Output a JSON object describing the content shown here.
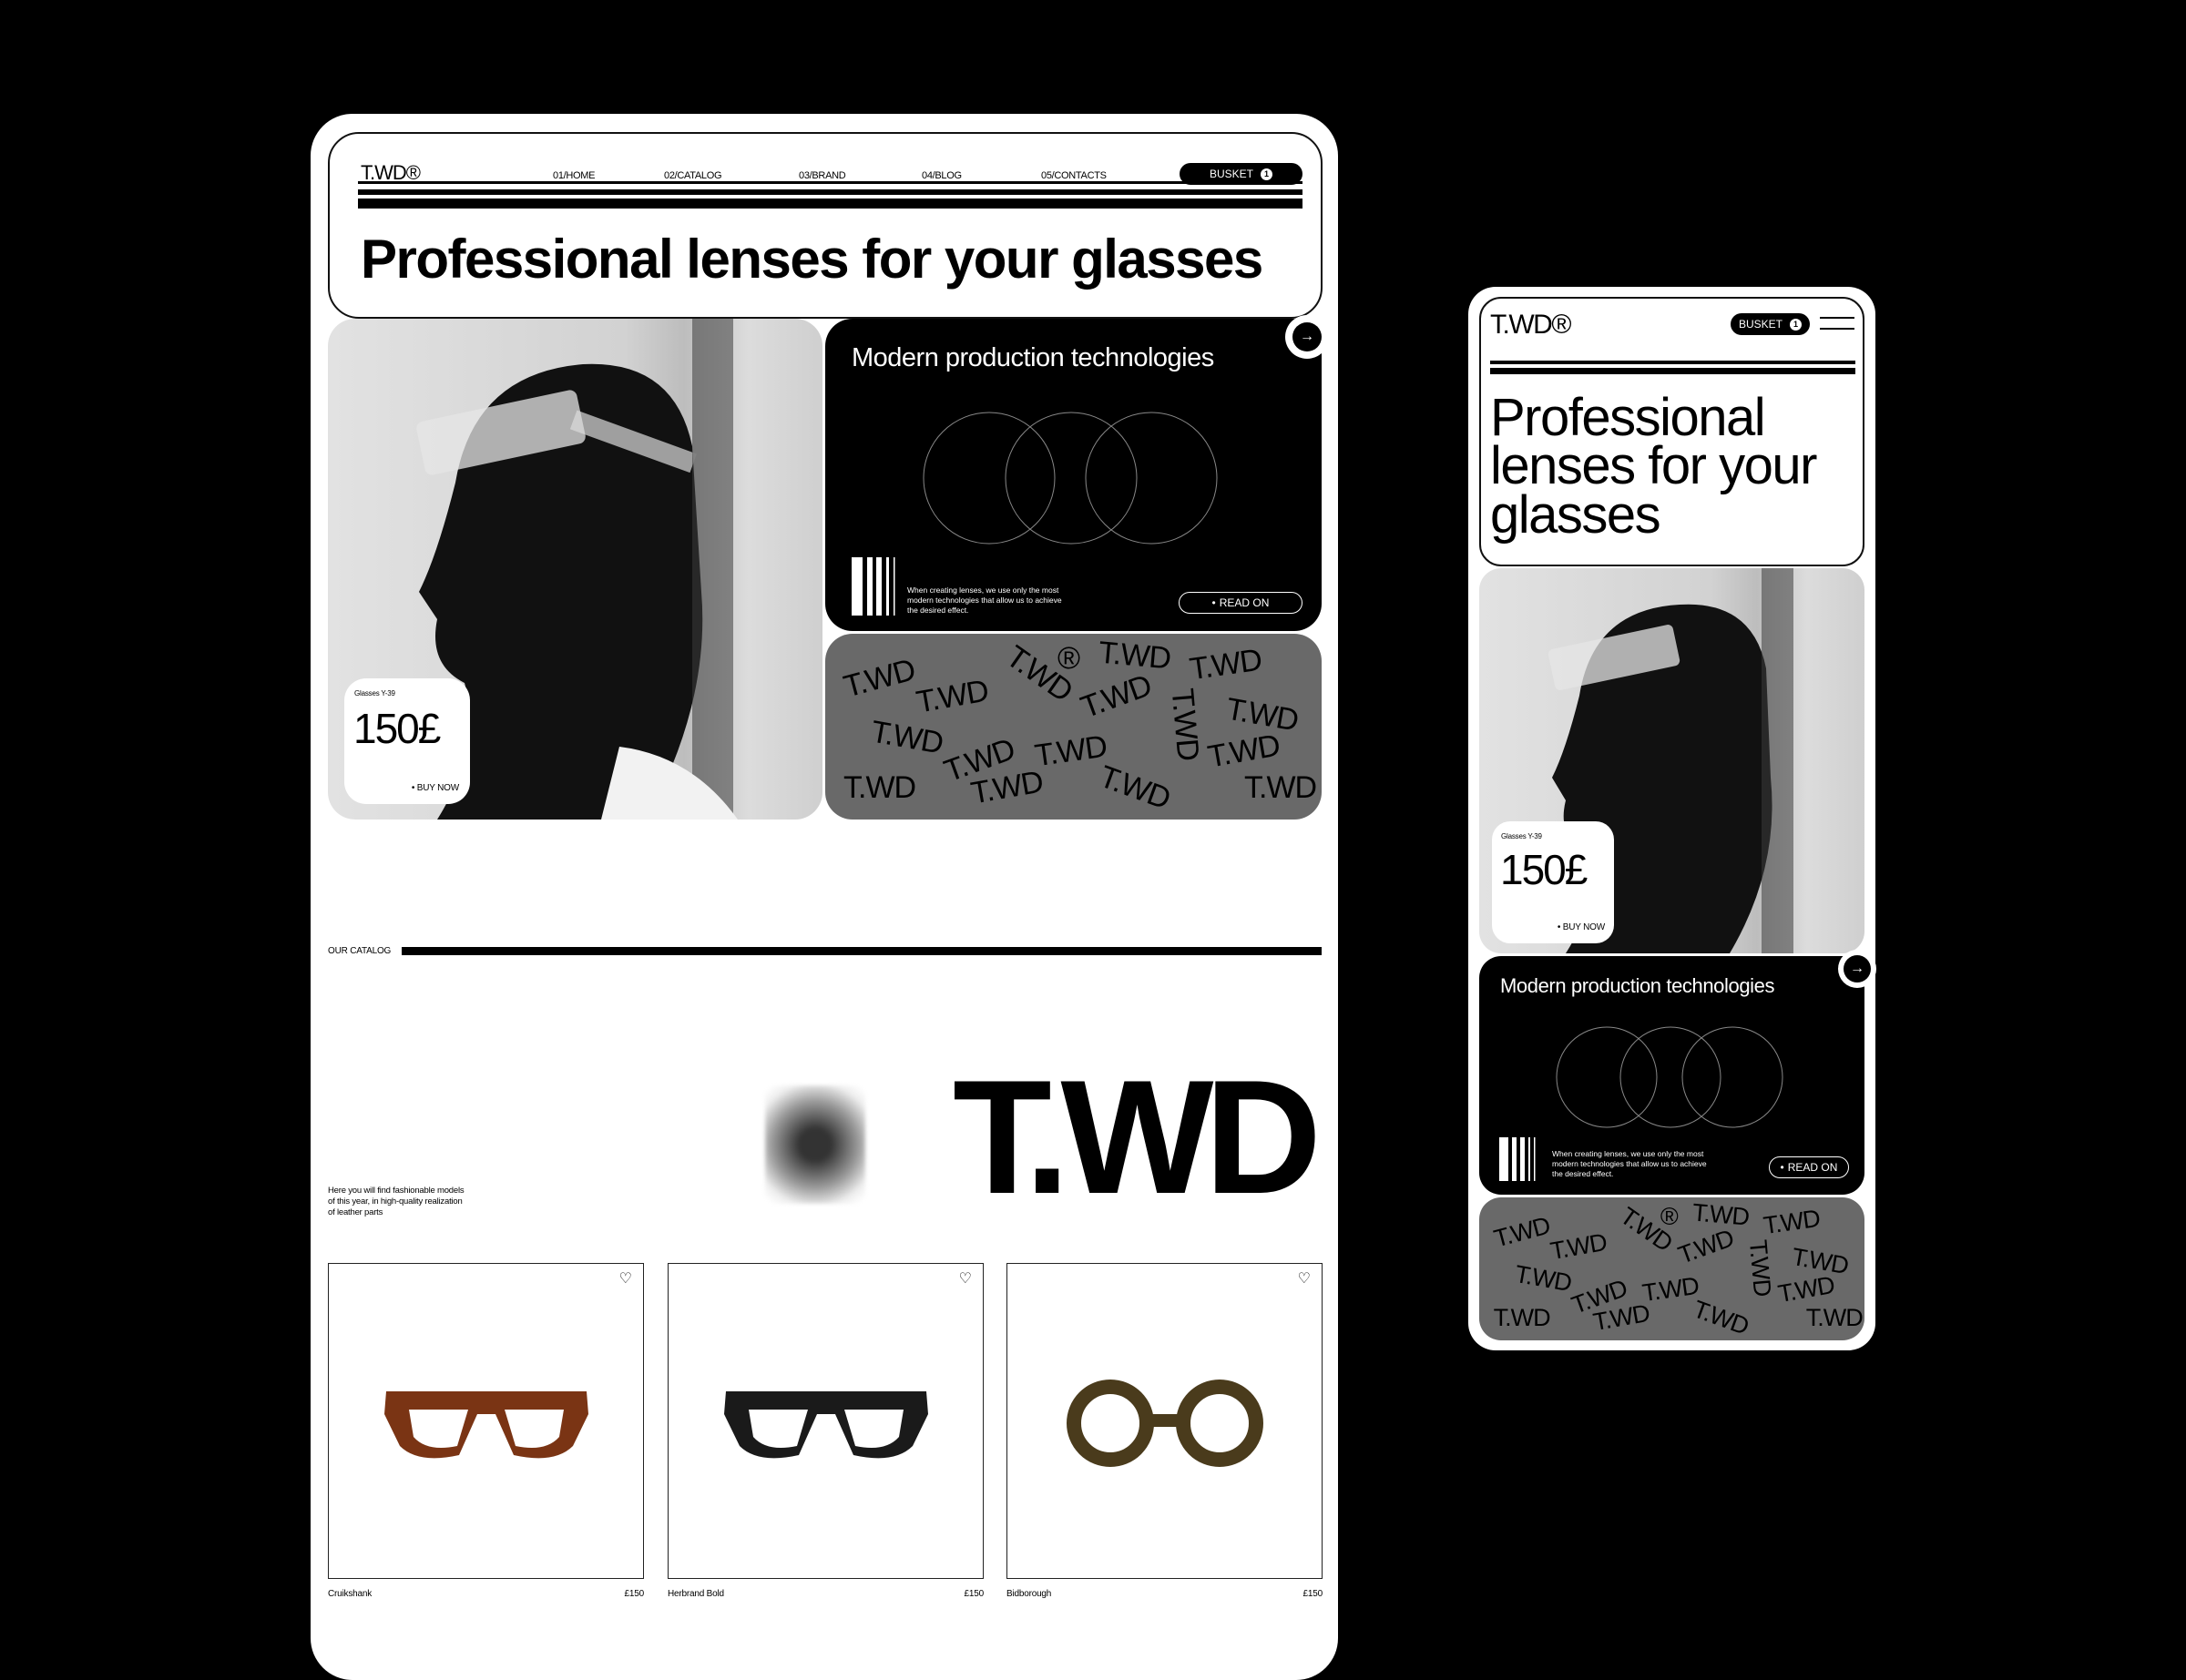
{
  "brand": {
    "logo": "T.WD®",
    "big_logo": "T.WD"
  },
  "nav": {
    "items": [
      "01/HOME",
      "02/CATALOG",
      "03/BRAND",
      "04/BLOG",
      "05/CONTACTS"
    ],
    "basket_label": "BUSKET",
    "basket_count": "1"
  },
  "hero": {
    "headline": "Professional lenses for your glasses",
    "mobile_headline_lines": [
      "Professional",
      "lenses for your",
      "glasses"
    ]
  },
  "product_promo": {
    "name": "Glasses Y-39",
    "price": "150£",
    "cta": "BUY NOW"
  },
  "tech": {
    "title": "Modern production technologies",
    "text": "When creating lenses, we use only the most modern technologies that allow us to achieve the desired effect.",
    "cta": "READ ON"
  },
  "pattern": {
    "text": "T.WD",
    "mark": "®"
  },
  "catalog": {
    "label": "OUR CATALOG",
    "description": "Here you will find fashionable models of this year, in high-quality realization of leather parts",
    "products": [
      {
        "name": "Cruikshank",
        "price": "£150",
        "color": "#7a3414"
      },
      {
        "name": "Herbrand Bold",
        "price": "£150",
        "color": "#1a1a1a"
      },
      {
        "name": "Bidborough",
        "price": "£150",
        "color": "#4a3b1c"
      }
    ]
  },
  "colors": {
    "background": "#000000",
    "surface": "#ffffff",
    "pattern_gray": "#696969"
  }
}
